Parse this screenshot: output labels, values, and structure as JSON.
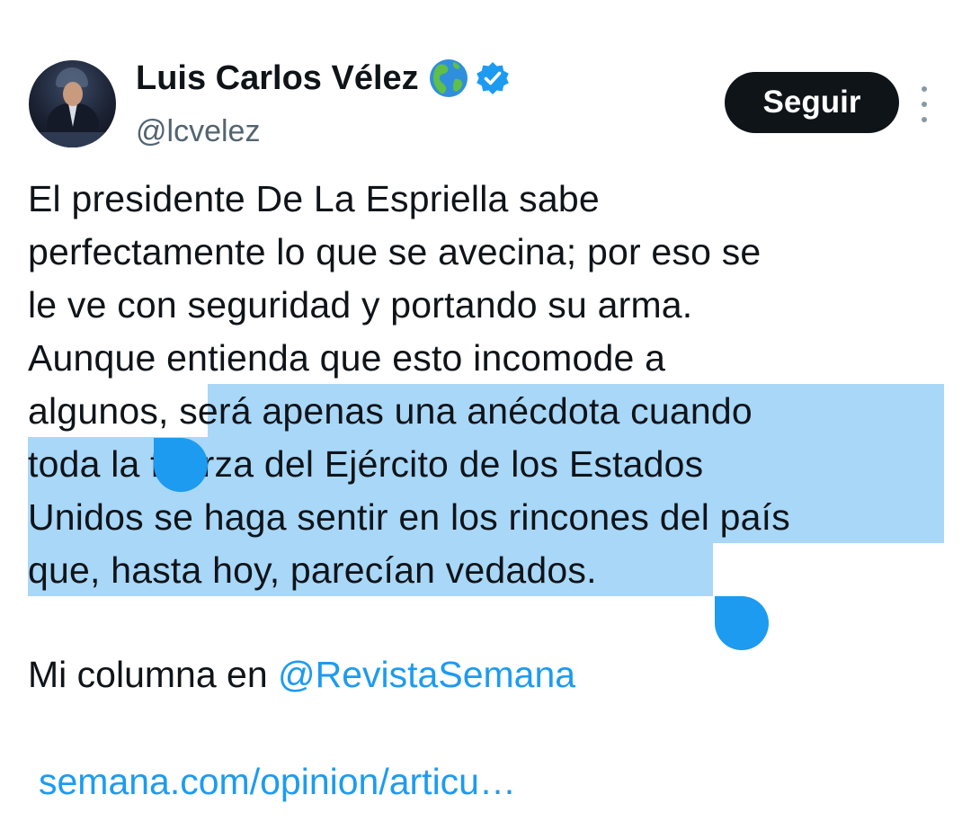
{
  "author": {
    "name": "Luis Carlos Vélez",
    "handle": "@lcvelez",
    "globe_emoji": "🌎"
  },
  "actions": {
    "follow_label": "Seguir"
  },
  "tweet": {
    "lines_before": [
      "El presidente De La Espriella sabe",
      "perfectamente lo que se avecina; por eso se",
      "le ve con seguridad y portando su arma.",
      "Aunque entienda que esto incomode a"
    ],
    "line5_plain": "algunos, ",
    "line5_selected": "será apenas una anécdota cuando",
    "line6": "toda la fuerza del Ejército de los Estados",
    "line7": "Unidos se haga sentir en los rincones del país",
    "line8": "que, hasta hoy, parecían vedados.",
    "mention_prefix": "Mi columna en ",
    "mention": "@RevistaSemana",
    "link_text": "semana.com/opinion/articu…"
  },
  "colors": {
    "selection": "#a8d7f8",
    "link": "#1d9bf0",
    "text": "#0f1419",
    "muted": "#536471"
  }
}
